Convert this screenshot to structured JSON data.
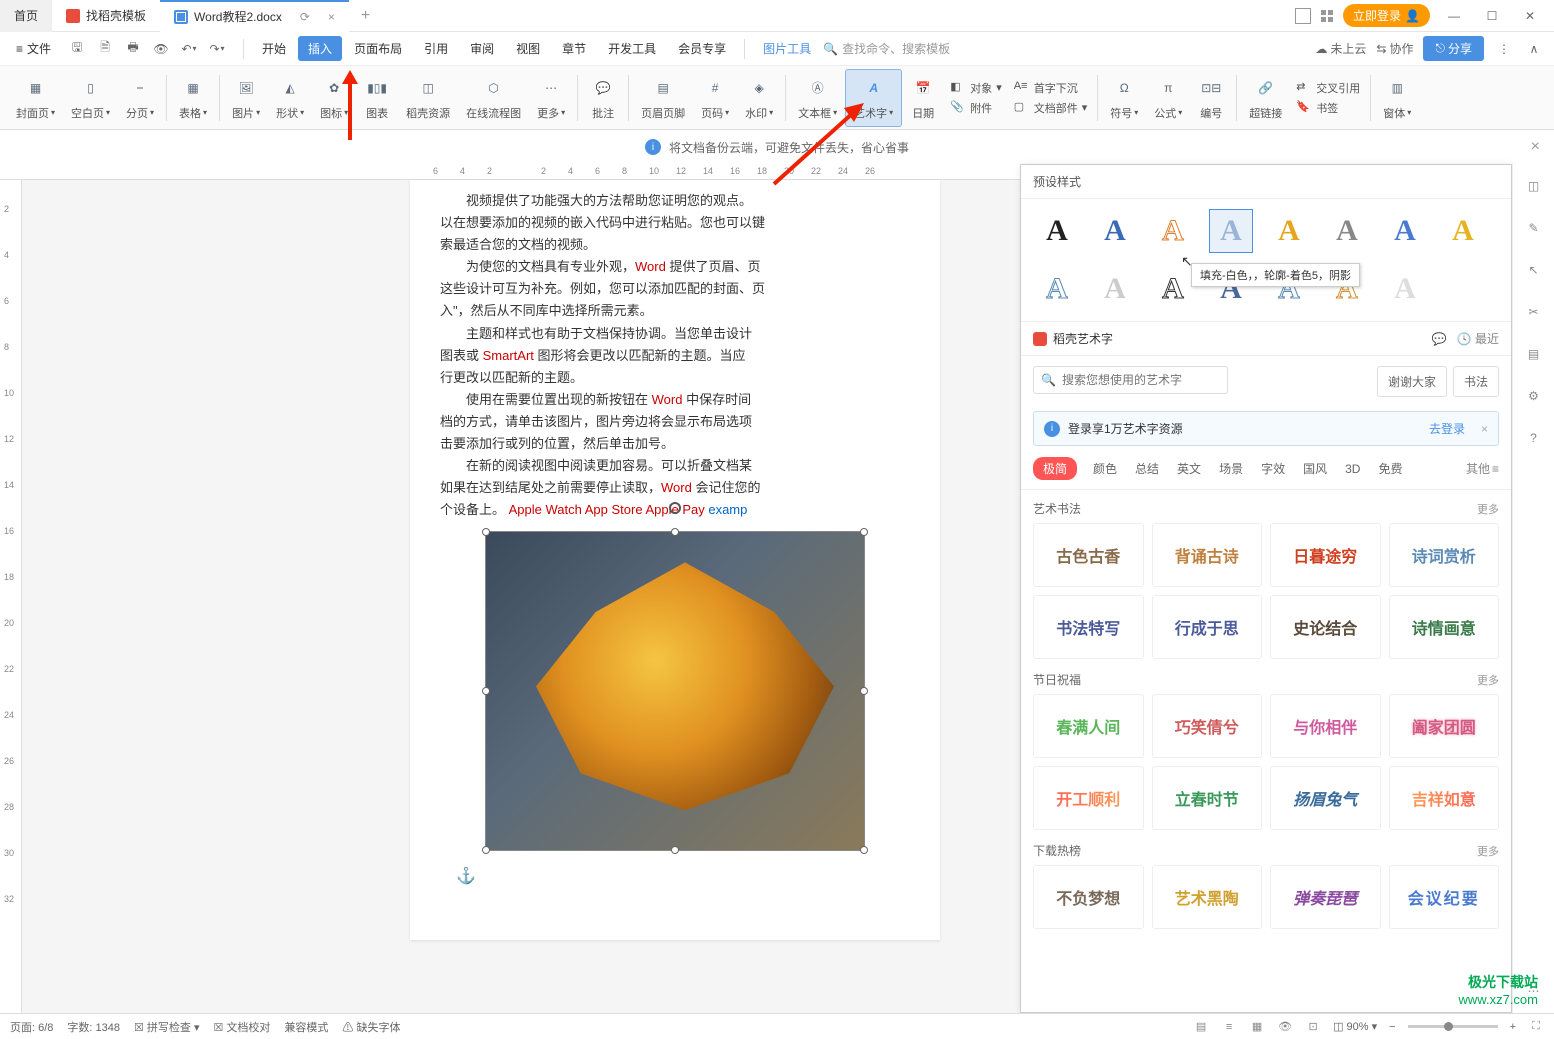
{
  "titlebar": {
    "home": "首页",
    "template": "找稻壳模板",
    "doc": "Word教程2.docx",
    "login": "立即登录"
  },
  "menubar": {
    "file": "文件",
    "items": [
      "开始",
      "插入",
      "页面布局",
      "引用",
      "审阅",
      "视图",
      "章节",
      "开发工具",
      "会员专享"
    ],
    "pic_tool": "图片工具",
    "search_ph": "查找命令、搜索模板",
    "not_cloud": "未上云",
    "collab": "协作",
    "share": "分享"
  },
  "ribbon": {
    "cover": "封面页",
    "blank": "空白页",
    "pager": "分页",
    "table": "表格",
    "pic": "图片",
    "shape": "形状",
    "icon": "图标",
    "chart": "图表",
    "docer": "稻壳资源",
    "flow": "在线流程图",
    "more": "更多",
    "comment": "批注",
    "header": "页眉页脚",
    "pgnum": "页码",
    "water": "水印",
    "textbox": "文本框",
    "wordart": "艺术字",
    "date": "日期",
    "obj": "对象",
    "dropcap": "首字下沉",
    "attach": "附件",
    "parts": "文档部件",
    "symbol": "符号",
    "formula": "公式",
    "num": "编号",
    "link": "超链接",
    "xref": "交叉引用",
    "bmk": "书签",
    "pane": "窗体"
  },
  "infobar": {
    "text": "将文档备份云端，可避免文件丢失，省心省事"
  },
  "ruler_h": [
    "6",
    "4",
    "2",
    "",
    "2",
    "4",
    "6",
    "8",
    "10",
    "12",
    "14",
    "16",
    "18",
    "20",
    "22",
    "24",
    "26"
  ],
  "ruler_v": [
    "",
    "2",
    "4",
    "6",
    "8",
    "10",
    "12",
    "14",
    "16",
    "18",
    "20",
    "22",
    "24",
    "26",
    "28",
    "30",
    "32"
  ],
  "doc": {
    "p1": "视频提供了功能强大的方法帮助您证明您的观点。",
    "p2a": "以在想要添加的视频的嵌入代码中进行粘贴。您也可以键",
    "p2b": "索最适合您的文档的视频。",
    "p3a": "为使您的文档具有专业外观，",
    "p3w": "Word",
    "p3b": " 提供了页眉、页",
    "p4": "这些设计可互为补充。例如，您可以添加匹配的封面、页",
    "p5": "入\"，然后从不同库中选择所需元素。",
    "p6a": "主题和样式也有助于文档保持协调。当您单击设计",
    "p7a": "图表或 ",
    "p7w": "SmartArt",
    "p7b": " 图形将会更改以匹配新的主题。当应",
    "p8": "行更改以匹配新的主题。",
    "p9a": "使用在需要位置出现的新按钮在 ",
    "p9w": "Word",
    "p9b": " 中保存时间",
    "p10": "档的方式，请单击该图片，图片旁边将会显示布局选项",
    "p11": "击要添加行或列的位置，然后单击加号。",
    "p12": "在新的阅读视图中阅读更加容易。可以折叠文档某",
    "p13a": "如果在达到结尾处之前需要停止读取，",
    "p13w": "Word",
    "p13b": " 会记住您的",
    "p14a": "个设备上。  ",
    "p14b": "Apple Watch",
    "p14c": "    App Store",
    "p14d": "    Apple Pay",
    "p14e": "    examp"
  },
  "wa": {
    "header": "预设样式",
    "tooltip": "填充-白色，，轮廓-着色5，阴影",
    "docer": "稻壳艺术字",
    "recent": "最近",
    "search_ph": "搜索您想使用的艺术字",
    "chip1": "谢谢大家",
    "chip2": "书法",
    "login_text": "登录享1万艺术字资源",
    "login_link": "去登录",
    "tabs": [
      "极简",
      "颜色",
      "总结",
      "英文",
      "场景",
      "字效",
      "国风",
      "3D",
      "免费"
    ],
    "tab_other": "其他",
    "sections": {
      "s1": {
        "title": "艺术书法",
        "more": "更多",
        "items": [
          "古色古香",
          "背诵古诗",
          "日暮途穷",
          "诗词赏析",
          "书法特写",
          "行成于思",
          "史论结合",
          "诗情画意"
        ]
      },
      "s2": {
        "title": "节日祝福",
        "more": "更多",
        "items": [
          "春满人间",
          "巧笑倩兮",
          "与你相伴",
          "阖家团圆",
          "开工顺利",
          "立春时节",
          "扬眉兔气",
          "吉祥如意"
        ]
      },
      "s3": {
        "title": "下载热榜",
        "more": "更多",
        "items": [
          "不负梦想",
          "艺术黑陶",
          "弹奏琵琶",
          "会议纪要"
        ]
      }
    }
  },
  "status": {
    "page": "页面: 6/8",
    "words": "字数: 1348",
    "spell": "拼写检查",
    "proof": "文档校对",
    "compat": "兼容模式",
    "miss": "缺失字体",
    "zoom": "90%"
  },
  "watermark": {
    "l1": "极光下载站",
    "l2": "www.xz7.com"
  }
}
